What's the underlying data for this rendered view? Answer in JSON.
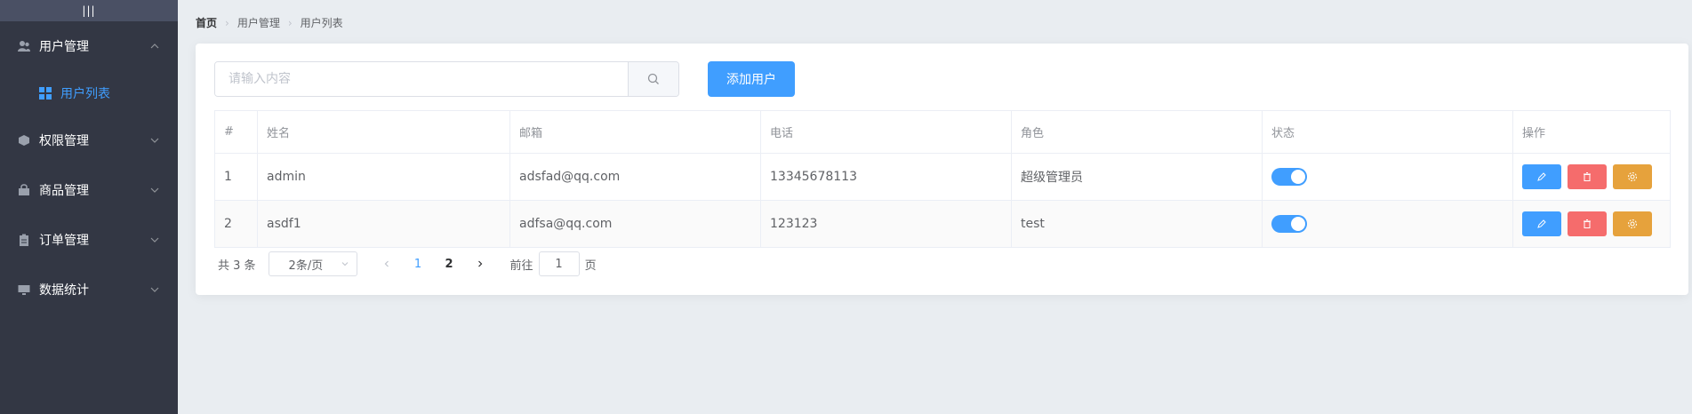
{
  "sidebar": {
    "toggle_label": "|||",
    "menus": [
      {
        "label": "用户管理",
        "icon": "users-icon",
        "expanded": true
      },
      {
        "label": "权限管理",
        "icon": "box-icon"
      },
      {
        "label": "商品管理",
        "icon": "bag-icon"
      },
      {
        "label": "订单管理",
        "icon": "clipboard-icon"
      },
      {
        "label": "数据统计",
        "icon": "monitor-icon"
      }
    ],
    "submenu": {
      "label": "用户列表",
      "icon": "grid-icon",
      "active": true
    }
  },
  "breadcrumb": {
    "home": "首页",
    "level1": "用户管理",
    "level2": "用户列表"
  },
  "search": {
    "placeholder": "请输入内容"
  },
  "add_button_label": "添加用户",
  "table": {
    "headers": [
      "#",
      "姓名",
      "邮箱",
      "电话",
      "角色",
      "状态",
      "操作"
    ],
    "rows": [
      {
        "index": "1",
        "name": "admin",
        "email": "adsfad@qq.com",
        "phone": "13345678113",
        "role": "超级管理员",
        "status": true
      },
      {
        "index": "2",
        "name": "asdf1",
        "email": "adfsa@qq.com",
        "phone": "123123",
        "role": "test",
        "status": true
      }
    ]
  },
  "pagination": {
    "total_text": "共 3 条",
    "page_size": "2条/页",
    "pages": [
      "1",
      "2"
    ],
    "current_page": 1,
    "goto_label": "前往",
    "goto_value": "1",
    "page_suffix": "页"
  },
  "colors": {
    "sidebar_bg": "#333744",
    "accent": "#409eff",
    "danger": "#f56c6c",
    "warning": "#e6a23c",
    "page_bg": "#e9edf1"
  }
}
